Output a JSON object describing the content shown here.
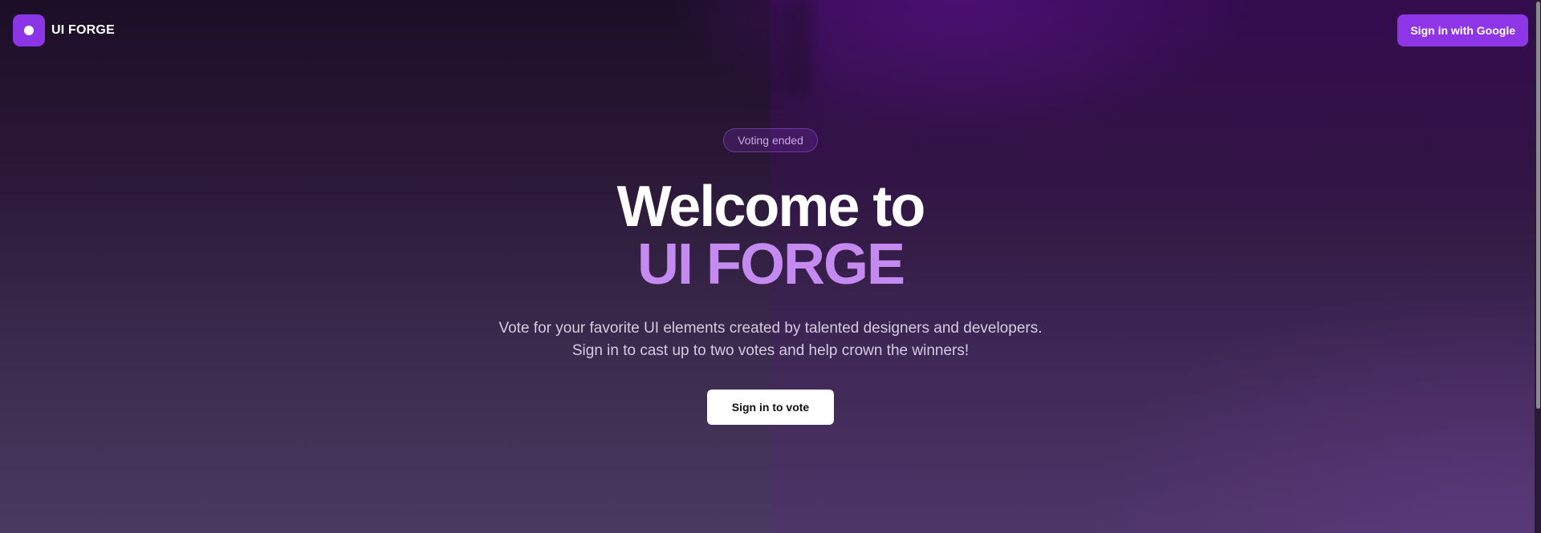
{
  "header": {
    "brand_name": "UI FORGE",
    "sign_in_label": "Sign in with Google"
  },
  "hero": {
    "badge": "Voting ended",
    "title_line1": "Welcome to",
    "title_line2": "UI FORGE",
    "subtitle": "Vote for your favorite UI elements created by talented designers and developers. Sign in to cast up to two votes and help crown the winners!",
    "cta_label": "Sign in to vote"
  },
  "colors": {
    "accent": "#8b35e6",
    "title_highlight": "#c58af0",
    "background_top": "#1c0e27",
    "background_bottom": "#4a3a60"
  },
  "icons": {
    "logo": "dot-logo-icon"
  }
}
